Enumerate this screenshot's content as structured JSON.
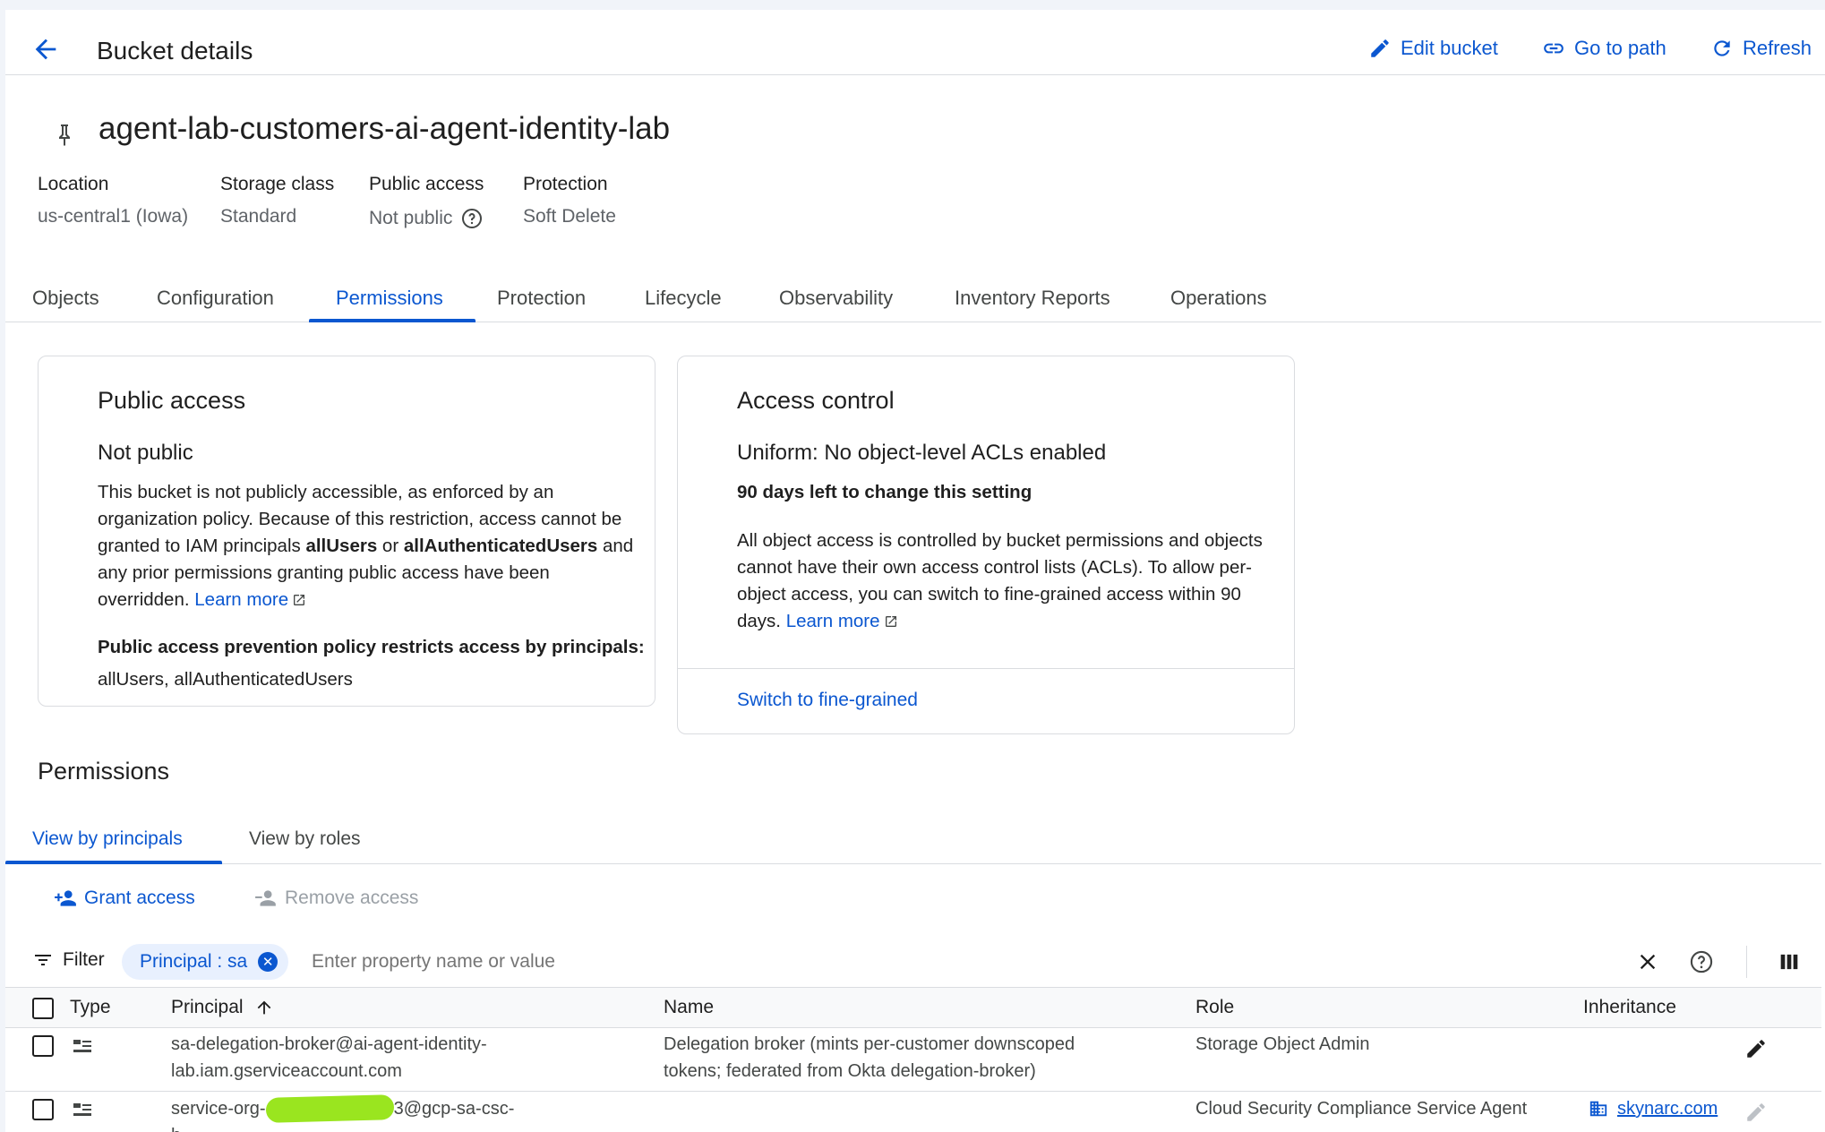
{
  "header": {
    "title": "Bucket details",
    "edit_label": "Edit bucket",
    "goto_label": "Go to path",
    "refresh_label": "Refresh"
  },
  "bucket": {
    "name": "agent-lab-customers-ai-agent-identity-lab",
    "meta": [
      {
        "label": "Location",
        "value": "us-central1 (Iowa)"
      },
      {
        "label": "Storage class",
        "value": "Standard"
      },
      {
        "label": "Public access",
        "value": "Not public"
      },
      {
        "label": "Protection",
        "value": "Soft Delete"
      }
    ]
  },
  "tabs": [
    "Objects",
    "Configuration",
    "Permissions",
    "Protection",
    "Lifecycle",
    "Observability",
    "Inventory Reports",
    "Operations"
  ],
  "public_card": {
    "title": "Public access",
    "subtitle": "Not public",
    "text_1": "This bucket is not publicly accessible, as enforced by an organization policy. Because of this restriction, access cannot be granted to IAM principals ",
    "bold_1": "allUsers",
    "text_2": " or ",
    "bold_2": "allAuthenticatedUsers",
    "text_3": " and any prior permissions granting public access have been overridden. ",
    "learn_more": "Learn more",
    "policy_heading": "Public access prevention policy restricts access by principals:",
    "policy_value": "allUsers, allAuthenticatedUsers"
  },
  "access_card": {
    "title": "Access control",
    "subtitle": "Uniform: No object-level ACLs enabled",
    "days_left": "90 days left to change this setting",
    "text": "All object access is controlled by bucket permissions and objects cannot have their own access control lists (ACLs). To allow per-object access, you can switch to fine-grained access within 90 days. ",
    "learn_more": "Learn more",
    "switch_label": "Switch to fine-grained"
  },
  "permissions": {
    "title": "Permissions",
    "view_principals": "View by principals",
    "view_roles": "View by roles",
    "grant_label": "Grant access",
    "remove_label": "Remove access",
    "filter_label": "Filter",
    "chip_label": "Principal : sa",
    "filter_placeholder": "Enter property name or value",
    "columns": [
      "Type",
      "Principal",
      "Name",
      "Role",
      "Inheritance"
    ],
    "rows": [
      {
        "principal_1": "sa-delegation-broker@ai-agent-identity-",
        "principal_2": "lab.iam.gserviceaccount.com",
        "name_1": "Delegation broker (mints per-customer downscoped",
        "name_2": "tokens; federated from Okta delegation-broker)",
        "role": "Storage Object Admin",
        "inheritance": ""
      },
      {
        "principal_1a": "service-org-",
        "principal_1b": "3@gcp-sa-csc-",
        "principal_2": "h",
        "name_1": "",
        "name_2": "",
        "role": "Cloud Security Compliance Service Agent",
        "inheritance": "skynarc.com"
      }
    ]
  },
  "colors": {
    "accent": "#0b57d0",
    "redaction": "#9ae51f"
  }
}
